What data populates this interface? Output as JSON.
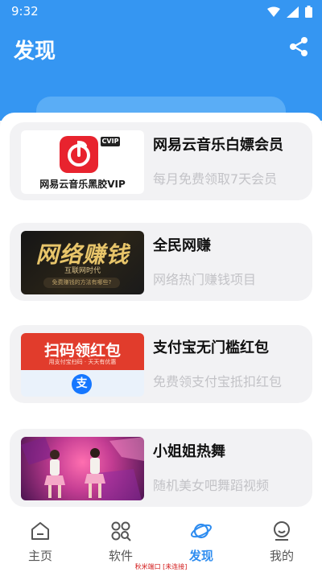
{
  "status_bar": {
    "time": "9:32"
  },
  "header": {
    "title": "发现"
  },
  "cards": [
    {
      "title": "网易云音乐白嫖会员",
      "subtitle": "每月免费领取7天会员",
      "thumb": {
        "tag": "CVIP",
        "caption": "网易云音乐黑胶VIP"
      }
    },
    {
      "title": "全民网赚",
      "subtitle": "网络热门赚钱项目",
      "thumb": {
        "headline": "网络赚钱",
        "sub": "互联网时代",
        "pill": "免费赚钱的方法有哪些?"
      }
    },
    {
      "title": "支付宝无门槛红包",
      "subtitle": "免费领支付宝抵扣红包",
      "thumb": {
        "headline": "扫码领红包",
        "sub": "用支付宝扫码 · 天天有优惠",
        "logo": "支"
      }
    },
    {
      "title": "小姐姐热舞",
      "subtitle": "随机美女吧舞蹈视频",
      "thumb": {}
    }
  ],
  "tabs": [
    {
      "label": "主页",
      "icon": "home-icon"
    },
    {
      "label": "软件",
      "icon": "apps-icon"
    },
    {
      "label": "发现",
      "icon": "planet-icon",
      "active": true
    },
    {
      "label": "我的",
      "icon": "profile-icon"
    }
  ],
  "port_note": "秋米端口 [未连接]",
  "colors": {
    "primary": "#3596f2",
    "active_tab": "#2f8df0",
    "subtitle": "#c3c3c7"
  }
}
